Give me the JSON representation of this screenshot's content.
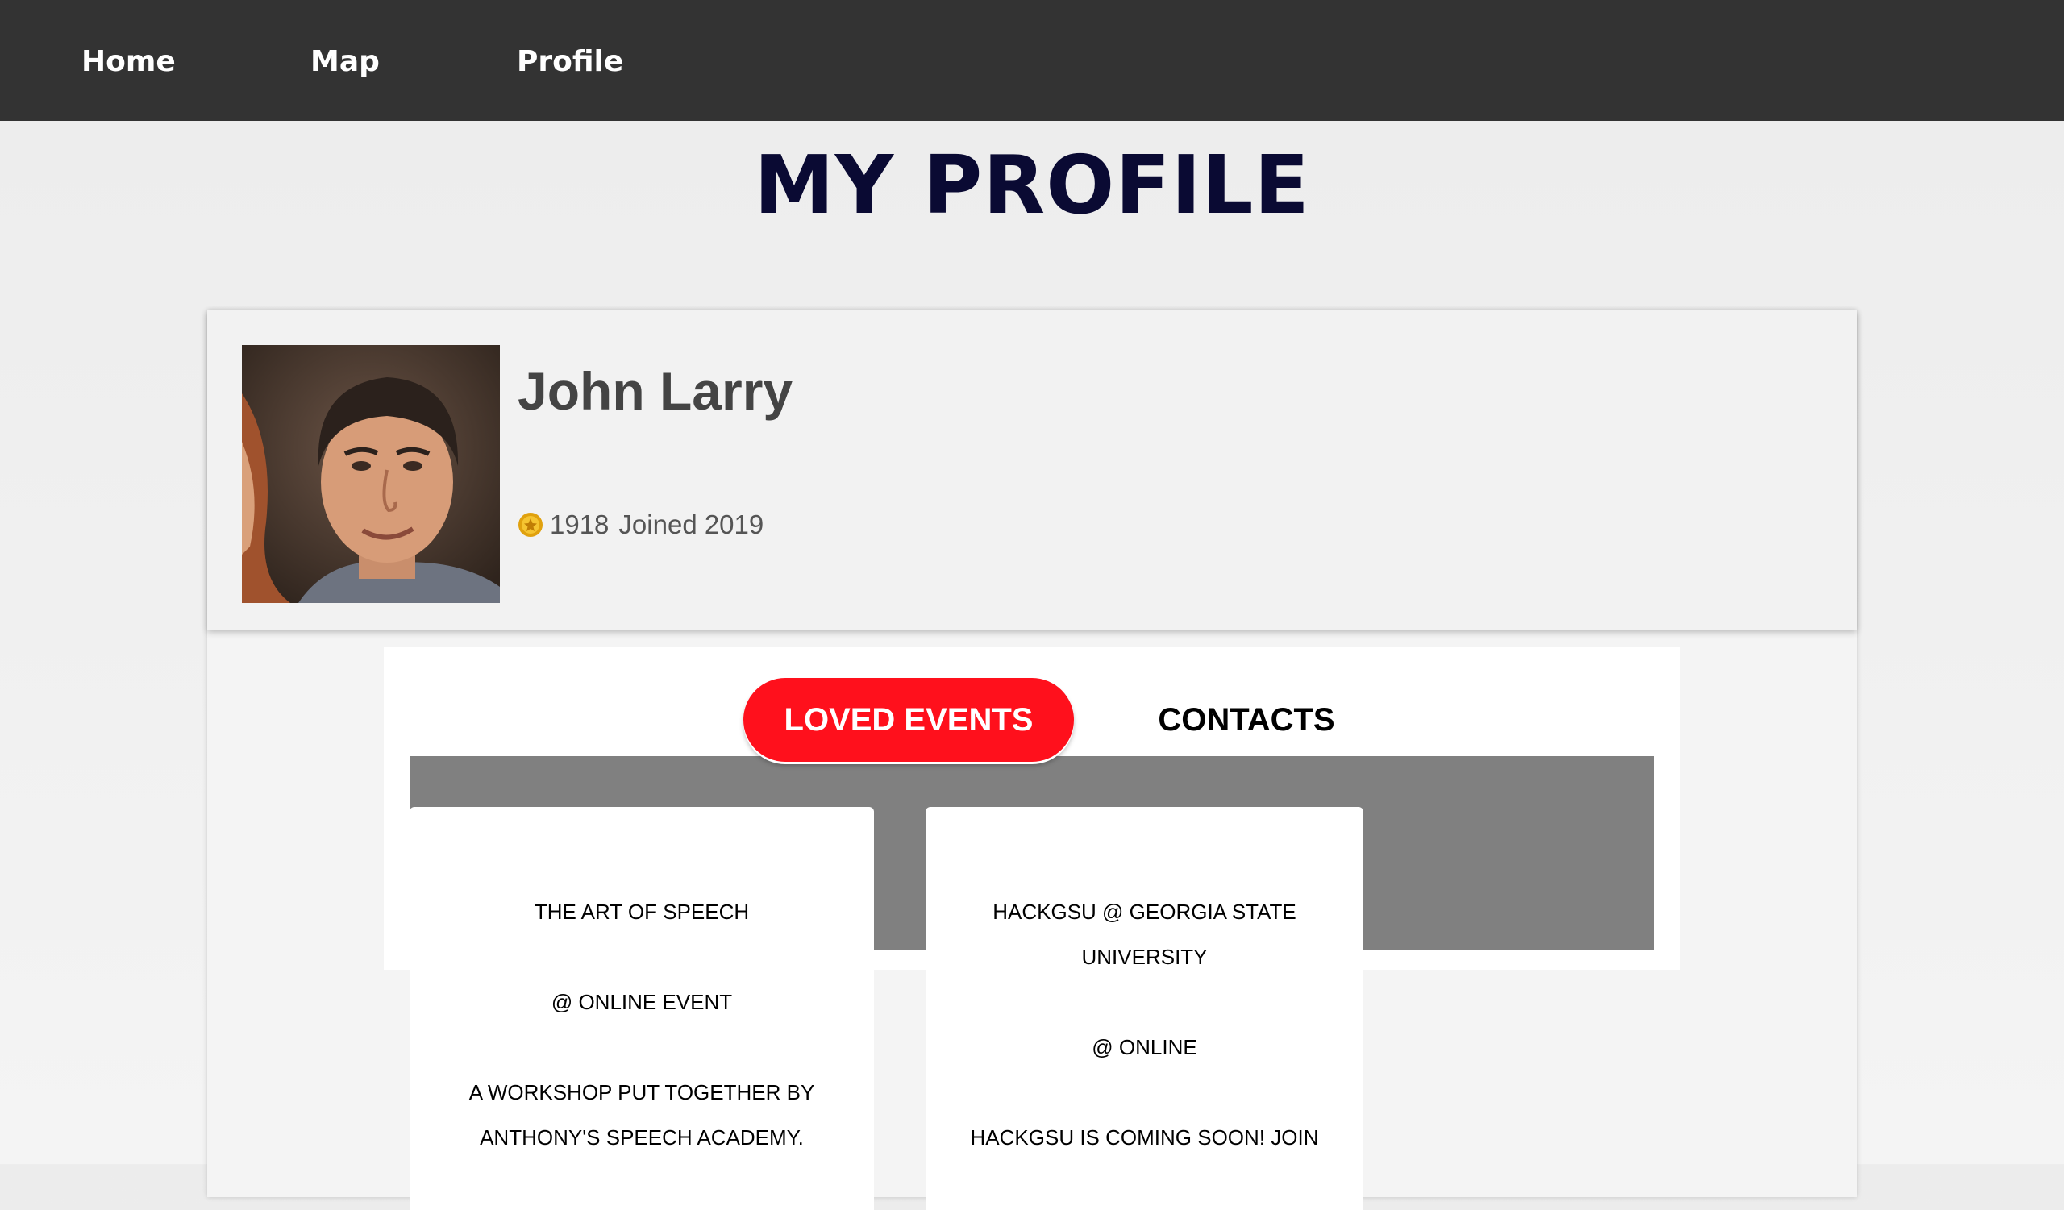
{
  "nav": {
    "items": [
      {
        "label": "Home"
      },
      {
        "label": "Map"
      },
      {
        "label": "Profile"
      }
    ]
  },
  "page": {
    "title": "MY PROFILE"
  },
  "profile": {
    "name": "John Larry",
    "points": "1918",
    "joined": "Joined 2019",
    "coin_icon": "coin-icon",
    "avatar_icon": "user-photo"
  },
  "tabs": [
    {
      "label": "LOVED EVENTS",
      "active": true
    },
    {
      "label": "CONTACTS",
      "active": false
    }
  ],
  "events": [
    {
      "title": "THE ART OF SPEECH",
      "location": "@ ONLINE EVENT",
      "description": "A WORKSHOP PUT TOGETHER BY ANTHONY'S SPEECH ACADEMY."
    },
    {
      "title": "HACKGSU @ GEORGIA STATE UNIVERSITY",
      "location": "@ ONLINE",
      "description": "HACKGSU IS COMING SOON! JOIN"
    }
  ],
  "colors": {
    "navbar": "#333333",
    "title": "#0a0a33",
    "active_tab": "#ff101c",
    "gray_area": "#808080"
  }
}
